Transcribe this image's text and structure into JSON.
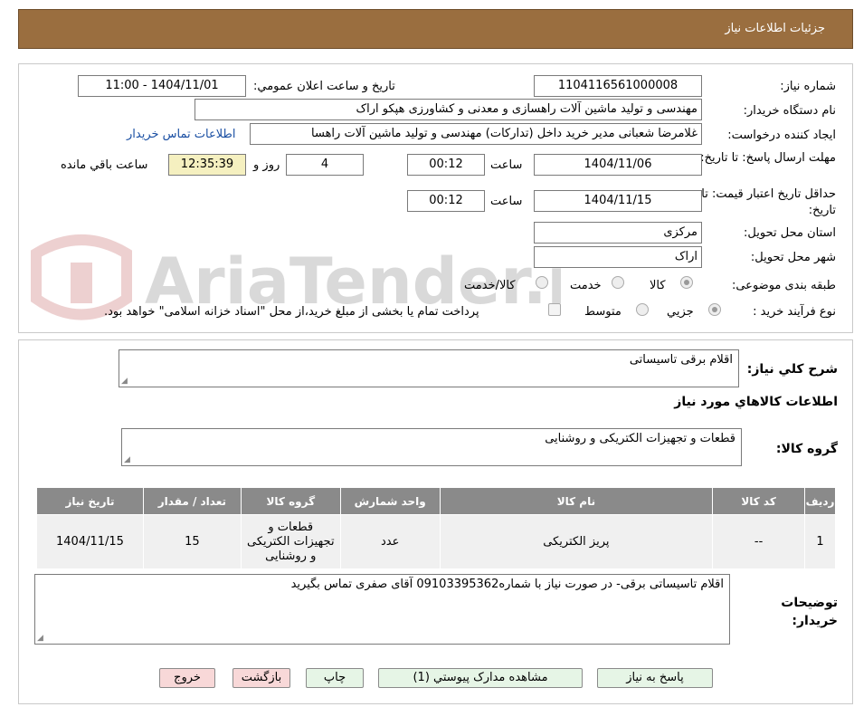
{
  "header": {
    "title": "جزئیات اطلاعات نیاز"
  },
  "watermark": "AriaTender.neT",
  "form": {
    "need_number_label": "شماره نیاز:",
    "need_number": "1104116561000008",
    "announce_label": "تاریخ و ساعت اعلان عمومي:",
    "announce_value": "1404/11/01 - 11:00",
    "buyer_label": "نام دستگاه خريدار:",
    "buyer_value": "مهندسی و تولید ماشین آلات راهسازی و معدنی و کشاورزی هپکو اراک",
    "creator_label": "ایجاد کننده درخواست:",
    "creator_value": "غلامرضا شعبانی مدیر خرید داخل (تدارکات) مهندسی و تولید ماشین آلات راهسا",
    "contact_link": "اطلاعات تماس خریدار",
    "deadline_label": "مهلت ارسال پاسخ: تا تاريخ:",
    "deadline_date": "1404/11/06",
    "time_label": "ساعت",
    "deadline_time": "00:12",
    "days_value": "4",
    "days_label": "روز و",
    "remaining_time": "12:35:39",
    "remaining_label": "ساعت باقي مانده",
    "validity_label": "حداقل تاريخ اعتبار قيمت: تا تاريخ:",
    "validity_date": "1404/11/15",
    "validity_time": "00:12",
    "province_label": "استان محل تحویل:",
    "province_value": "مرکزی",
    "city_label": "شهر محل تحویل:",
    "city_value": "اراک",
    "category_label": "طبقه بندی موضوعی:",
    "category_options": [
      "کالا",
      "خدمت",
      "کالا/خدمت"
    ],
    "category_selected": "کالا",
    "process_label": "نوع فرآیند خرید :",
    "process_options": [
      "جزیي",
      "متوسط"
    ],
    "process_selected": "جزیي",
    "payment_note": "پرداخت تمام یا بخشی از مبلغ خرید،از محل \"اسناد خزانه اسلامی\" خواهد بود."
  },
  "details": {
    "summary_label": "شرح کلي نياز:",
    "summary_value": "اقلام برقی تاسیساتی",
    "goods_info_title": "اطلاعات کالاهاي مورد نياز",
    "goods_group_label": "گروه کالا:",
    "goods_group_value": "قطعات و تجهیزات الکتریکی و روشنایی",
    "table": {
      "headers": [
        "رديف",
        "کد کالا",
        "نام کالا",
        "واحد شمارش",
        "گروه کالا",
        "تعداد / مقدار",
        "تاريخ نياز"
      ],
      "rows": [
        [
          "1",
          "--",
          "پریز الکتریکی",
          "عدد",
          "قطعات و تجهیزات الکتریکی و روشنایی",
          "15",
          "1404/11/15"
        ]
      ]
    },
    "buyer_notes_label": "توضیحات خریدار:",
    "buyer_notes_value": "اقلام تاسیساتی برقی- در صورت نیاز با شماره09103395362  آقای صفری تماس بگیرید"
  },
  "buttons": {
    "reply": "پاسخ به نياز",
    "attachments": "مشاهده مدارک پيوستي (1)",
    "print": "چاپ",
    "back": "بازگشت",
    "exit": "خروج"
  },
  "colors": {
    "header": "#9a6e3f",
    "table_header": "#8a8a8a",
    "link": "#1a4fa3",
    "timer": "#f5f0c0"
  }
}
